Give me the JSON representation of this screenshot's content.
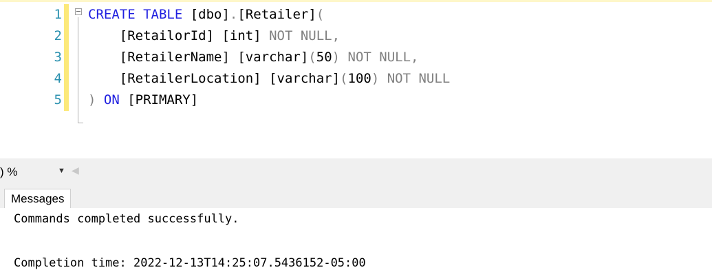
{
  "editor": {
    "lines": [
      {
        "num": "1",
        "tokens": [
          {
            "t": "CREATE TABLE ",
            "c": "kw"
          },
          {
            "t": "[dbo]",
            "c": ""
          },
          {
            "t": ".",
            "c": "gr"
          },
          {
            "t": "[Retailer]",
            "c": ""
          },
          {
            "t": "(",
            "c": "gr"
          }
        ]
      },
      {
        "num": "2",
        "tokens": [
          {
            "t": "    [RetailorId] [int] ",
            "c": ""
          },
          {
            "t": "NOT NULL,",
            "c": "gr"
          }
        ]
      },
      {
        "num": "3",
        "tokens": [
          {
            "t": "    [RetailerName] [varchar]",
            "c": ""
          },
          {
            "t": "(",
            "c": "gr"
          },
          {
            "t": "50",
            "c": ""
          },
          {
            "t": ") NOT NULL,",
            "c": "gr"
          }
        ]
      },
      {
        "num": "4",
        "tokens": [
          {
            "t": "    [RetailerLocation] [varchar]",
            "c": ""
          },
          {
            "t": "(",
            "c": "gr"
          },
          {
            "t": "100",
            "c": ""
          },
          {
            "t": ") NOT NULL",
            "c": "gr"
          }
        ]
      },
      {
        "num": "5",
        "tokens": [
          {
            "t": ")",
            "c": "gr"
          },
          {
            "t": " ON ",
            "c": "kw"
          },
          {
            "t": "[PRIMARY]",
            "c": ""
          }
        ]
      }
    ]
  },
  "statusbar": {
    "zoom": ") %",
    "zoom_dropdown_icon": "caret-down-icon",
    "scroll_left_icon": "scroll-left-icon"
  },
  "results": {
    "tab_label": "Messages",
    "lines": [
      "Commands completed successfully.",
      "",
      "Completion time: 2022-12-13T14:25:07.5436152-05:00"
    ]
  },
  "colors": {
    "keyword": "#1f1fe0",
    "gray": "#808080",
    "line_number": "#2b91af",
    "change_bar": "#fce97a"
  }
}
